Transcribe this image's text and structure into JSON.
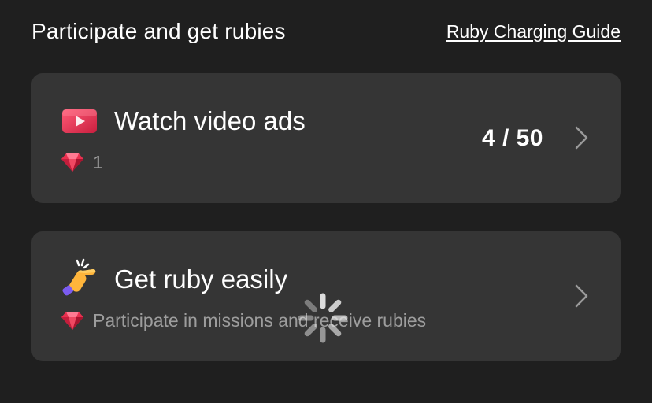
{
  "header": {
    "title": "Participate and get rubies",
    "guide_link": "Ruby Charging Guide"
  },
  "cards": [
    {
      "icon": "video-play-icon",
      "title": "Watch video ads",
      "reward_icon": "ruby-gem-icon",
      "subtitle": "1",
      "progress": "4 / 50",
      "chevron": "chevron-right-icon"
    },
    {
      "icon": "pointing-hand-icon",
      "title": "Get ruby easily",
      "reward_icon": "ruby-gem-icon",
      "subtitle": "Participate in missions and receive rubies",
      "chevron": "chevron-right-icon"
    }
  ],
  "overlay": {
    "icon": "loading-spinner-icon"
  },
  "colors": {
    "background": "#1f1f1f",
    "card": "#353535",
    "text_primary": "#ffffff",
    "text_secondary": "#9d9d9d",
    "accent_red": "#e8304f"
  }
}
